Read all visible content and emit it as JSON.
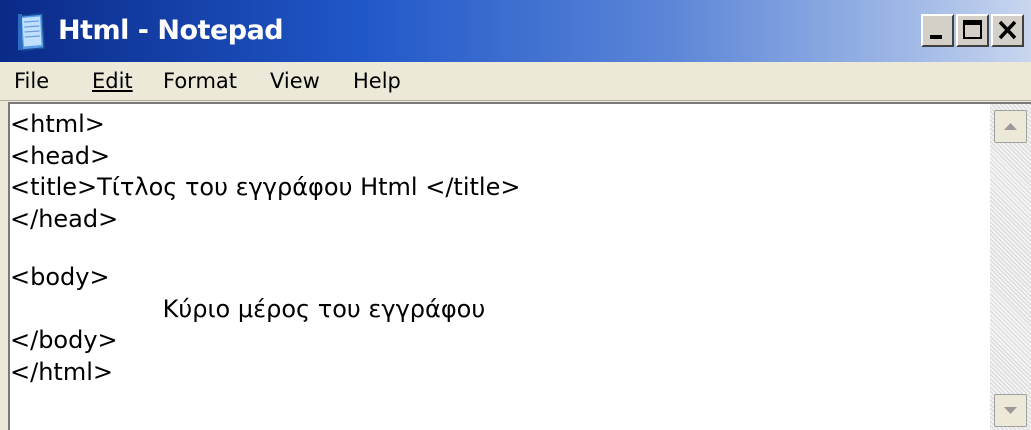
{
  "window": {
    "title": "Html - Notepad",
    "icon": "notepad-icon",
    "controls": [
      "minimize-icon",
      "maximize-icon",
      "close-icon"
    ]
  },
  "menu": {
    "items": [
      {
        "label": "File"
      },
      {
        "label": "Edit"
      },
      {
        "label": "Format"
      },
      {
        "label": "View"
      },
      {
        "label": "Help"
      }
    ]
  },
  "editor": {
    "lines": [
      "<html>",
      "<head>",
      "<title>Τίτλος του εγγράφου Html </title>",
      "</head>",
      "",
      "<body>",
      "                    Κύριο μέρος του εγγράφου",
      "</body>",
      "</html>"
    ]
  },
  "colors": {
    "titlebar_start": "#0a2a88",
    "titlebar_end": "#c9d6ee",
    "menubar": "#ece9d8",
    "editor_bg": "#ffffff"
  }
}
